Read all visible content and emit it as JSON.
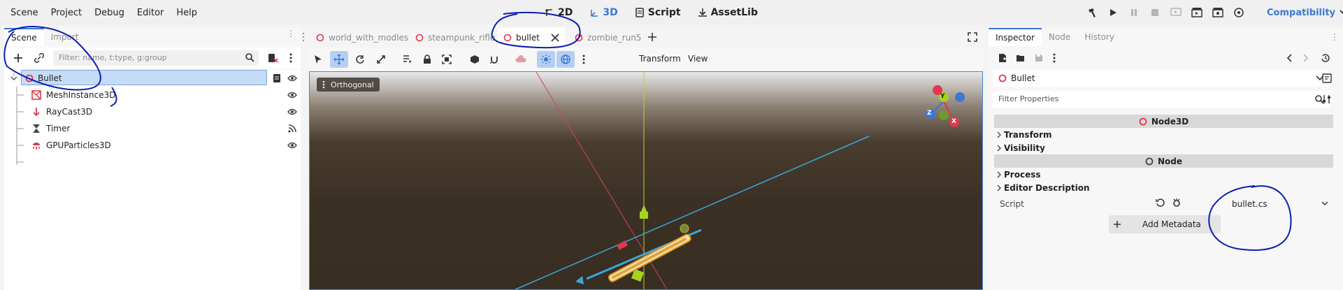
{
  "menu": {
    "items": [
      "Scene",
      "Project",
      "Debug",
      "Editor",
      "Help"
    ]
  },
  "workspaces": [
    {
      "label": "2D",
      "icon": "2d-icon",
      "active": false
    },
    {
      "label": "3D",
      "icon": "3d-icon",
      "active": true
    },
    {
      "label": "Script",
      "icon": "script-icon",
      "active": false
    },
    {
      "label": "AssetLib",
      "icon": "assetlib-icon",
      "active": false
    }
  ],
  "renderer": {
    "label": "Compatibility"
  },
  "left_dock": {
    "tabs": [
      "Scene",
      "Import"
    ],
    "filter_placeholder": "Filter: name, t:type, g:group",
    "tree": [
      {
        "label": "Bullet",
        "icon": "node3d-icon",
        "selected": true
      },
      {
        "label": "MeshInstance3D",
        "icon": "mesh-instance-icon"
      },
      {
        "label": "RayCast3D",
        "icon": "raycast-icon"
      },
      {
        "label": "Timer",
        "icon": "timer-icon"
      },
      {
        "label": "GPUParticles3D",
        "icon": "particles-icon"
      }
    ]
  },
  "scene_tabs": [
    {
      "label": "world_with_modles",
      "active": false
    },
    {
      "label": "steampunk_rifle",
      "active": false
    },
    {
      "label": "bullet",
      "active": true
    },
    {
      "label": "zombie_run5",
      "active": false
    }
  ],
  "viewport_toolbar": {
    "transform_label": "Transform",
    "view_label": "View"
  },
  "viewport": {
    "projection_label": "Orthogonal",
    "gizmo_axes": [
      "Y",
      "Z",
      "X"
    ]
  },
  "inspector": {
    "tabs": [
      "Inspector",
      "Node",
      "History"
    ],
    "object_name": "Bullet",
    "filter_placeholder": "Filter Properties",
    "sections": [
      {
        "title": "Node3D",
        "groups": [
          "Transform",
          "Visibility"
        ]
      },
      {
        "title": "Node",
        "groups": [
          "Process",
          "Editor Description"
        ]
      }
    ],
    "script_label": "Script",
    "script_value": "bullet.cs",
    "add_metadata_label": "Add Metadata"
  },
  "colors": {
    "accent": "#3a78d1",
    "selection": "#c6dbf6",
    "node_red": "#e0384d",
    "annotation_ink": "#0a1fb0"
  }
}
